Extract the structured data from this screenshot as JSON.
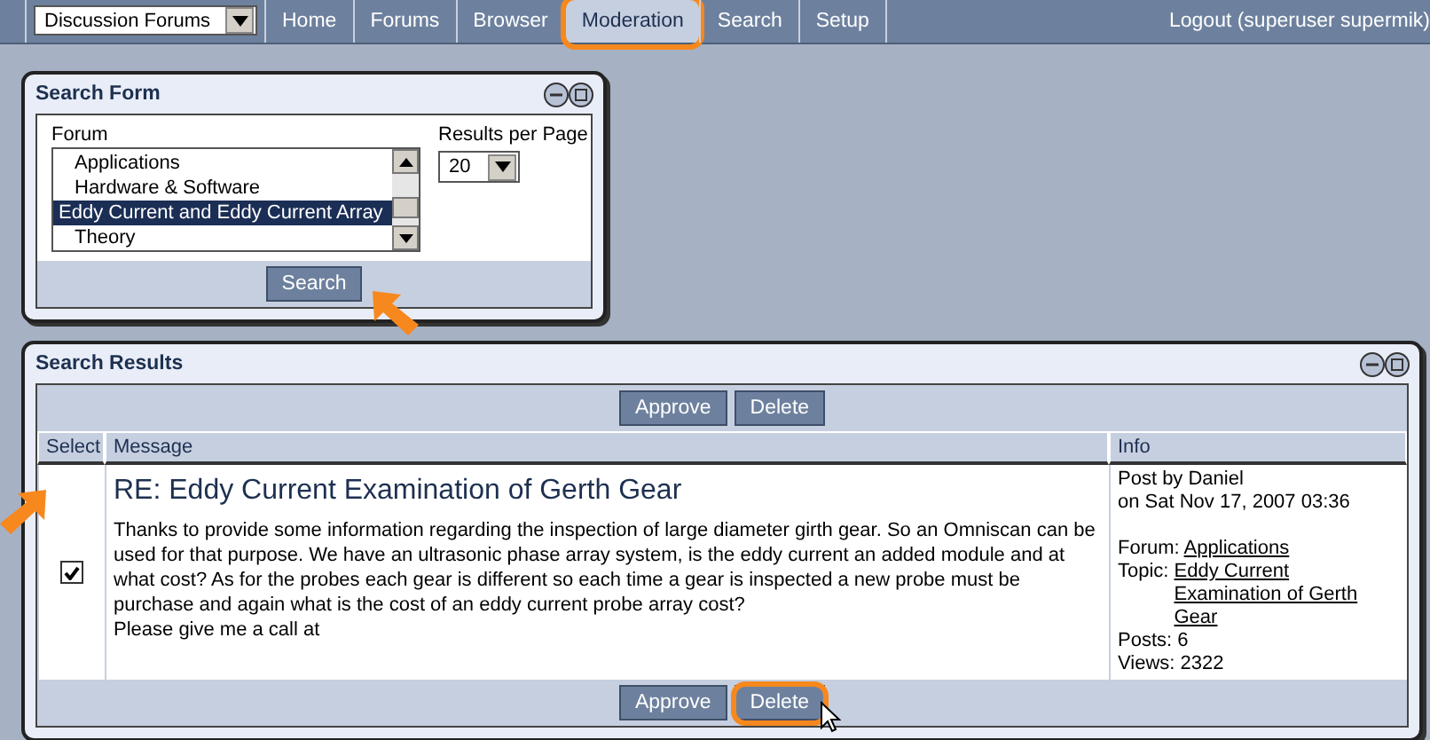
{
  "nav": {
    "forum_select": "Discussion Forums",
    "tabs": [
      {
        "label": "Home",
        "selected": false,
        "highlighted": false
      },
      {
        "label": "Forums",
        "selected": false,
        "highlighted": false
      },
      {
        "label": "Browser",
        "selected": false,
        "highlighted": false
      },
      {
        "label": "Moderation",
        "selected": true,
        "highlighted": true
      },
      {
        "label": "Search",
        "selected": false,
        "highlighted": false
      },
      {
        "label": "Setup",
        "selected": false,
        "highlighted": false
      }
    ],
    "logout": "Logout (superuser supermik)"
  },
  "search_form": {
    "title": "Search Form",
    "forum_label": "Forum",
    "forums": [
      {
        "label": "Applications",
        "selected": false
      },
      {
        "label": "Hardware & Software",
        "selected": false
      },
      {
        "label": "Eddy Current and Eddy Current Array",
        "selected": true
      },
      {
        "label": "Theory",
        "selected": false
      }
    ],
    "results_label": "Results per Page",
    "results_value": "20",
    "button": {
      "label": "Search",
      "pointer_arrow": true
    }
  },
  "search_results": {
    "title": "Search Results",
    "top_buttons": [
      {
        "label": "Approve",
        "highlighted": false,
        "cursor": false
      },
      {
        "label": "Delete",
        "highlighted": false,
        "cursor": false
      }
    ],
    "columns": [
      "Select",
      "Message",
      "Info"
    ],
    "rows": [
      {
        "checked": true,
        "pointer_arrow": true,
        "title": "RE: Eddy Current Examination of Gerth Gear",
        "body": [
          "Thanks to provide some information regarding the inspection of large diameter girth gear. So an Omniscan can be used for that purpose. We have an ultrasonic phase array system, is the eddy current an added module and at what cost? As for the probes each gear is different so each time a gear is inspected a new probe must be purchase and again what is the cost of an eddy current probe array cost?",
          "Please give me a call at"
        ],
        "post_by": "Post by Daniel",
        "date": "on Sat Nov 17, 2007 03:36",
        "forum_label": "Forum:",
        "forum_link": "Applications",
        "topic_label": "Topic:",
        "topic_link": "Eddy Current Examination of Gerth Gear",
        "posts": "Posts: 6",
        "views": "Views: 2322"
      }
    ],
    "bottom_buttons": [
      {
        "label": "Approve",
        "highlighted": false,
        "cursor": false
      },
      {
        "label": "Delete",
        "highlighted": true,
        "cursor": true
      }
    ]
  }
}
